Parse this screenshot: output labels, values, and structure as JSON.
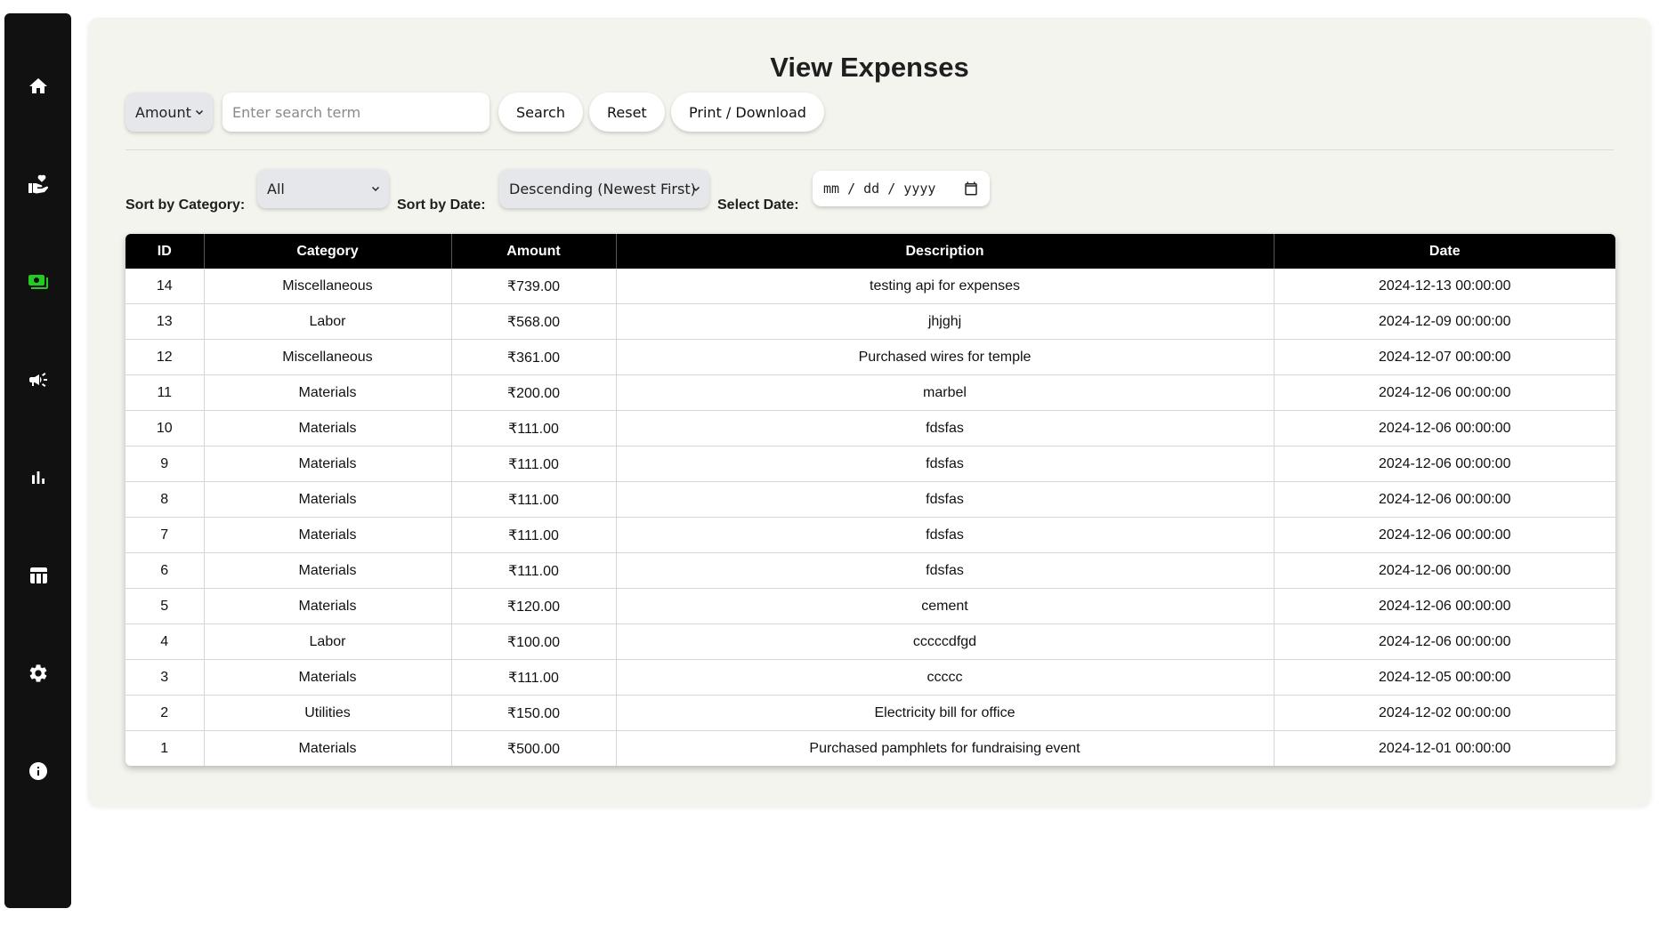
{
  "sidebar": {
    "items": [
      {
        "icon": "home-icon",
        "active": false
      },
      {
        "icon": "hand-heart-icon",
        "active": false
      },
      {
        "icon": "money-icon",
        "active": true
      },
      {
        "icon": "megaphone-icon",
        "active": false
      },
      {
        "icon": "bar-chart-icon",
        "active": false
      },
      {
        "icon": "table-icon",
        "active": false
      },
      {
        "icon": "settings-icon",
        "active": false
      },
      {
        "icon": "info-icon",
        "active": false
      }
    ],
    "active_color": "#22cc22",
    "icon_color": "#ffffff"
  },
  "page": {
    "title": "View Expenses"
  },
  "search": {
    "field_select": "Amount",
    "placeholder": "Enter search term",
    "value": "",
    "search_label": "Search",
    "reset_label": "Reset",
    "print_label": "Print / Download"
  },
  "filters": {
    "category_label": "Sort by Category:",
    "category_value": "All",
    "date_sort_label": "Sort by Date:",
    "date_sort_value": "Descending (Newest First)",
    "date_label": "Select Date:",
    "date_placeholder": "mm / dd / yyyy"
  },
  "table": {
    "headers": [
      "ID",
      "Category",
      "Amount",
      "Description",
      "Date"
    ],
    "rows": [
      [
        "14",
        "Miscellaneous",
        "₹739.00",
        "testing api for expenses",
        "2024-12-13 00:00:00"
      ],
      [
        "13",
        "Labor",
        "₹568.00",
        "jhjghj",
        "2024-12-09 00:00:00"
      ],
      [
        "12",
        "Miscellaneous",
        "₹361.00",
        "Purchased wires for temple",
        "2024-12-07 00:00:00"
      ],
      [
        "11",
        "Materials",
        "₹200.00",
        "marbel",
        "2024-12-06 00:00:00"
      ],
      [
        "10",
        "Materials",
        "₹111.00",
        "fdsfas",
        "2024-12-06 00:00:00"
      ],
      [
        "9",
        "Materials",
        "₹111.00",
        "fdsfas",
        "2024-12-06 00:00:00"
      ],
      [
        "8",
        "Materials",
        "₹111.00",
        "fdsfas",
        "2024-12-06 00:00:00"
      ],
      [
        "7",
        "Materials",
        "₹111.00",
        "fdsfas",
        "2024-12-06 00:00:00"
      ],
      [
        "6",
        "Materials",
        "₹111.00",
        "fdsfas",
        "2024-12-06 00:00:00"
      ],
      [
        "5",
        "Materials",
        "₹120.00",
        "cement",
        "2024-12-06 00:00:00"
      ],
      [
        "4",
        "Labor",
        "₹100.00",
        "cccccdfgd",
        "2024-12-06 00:00:00"
      ],
      [
        "3",
        "Materials",
        "₹111.00",
        "ccccc",
        "2024-12-05 00:00:00"
      ],
      [
        "2",
        "Utilities",
        "₹150.00",
        "Electricity bill for office",
        "2024-12-02 00:00:00"
      ],
      [
        "1",
        "Materials",
        "₹500.00",
        "Purchased pamphlets for fundraising event",
        "2024-12-01 00:00:00"
      ]
    ]
  }
}
